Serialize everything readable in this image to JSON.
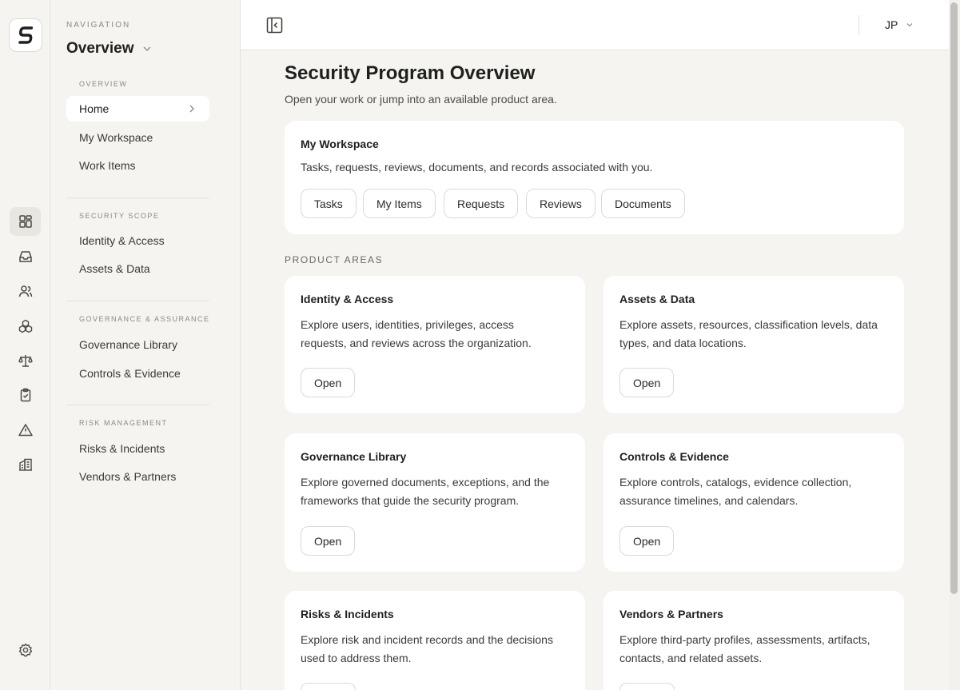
{
  "nav": {
    "eyebrow": "NAVIGATION",
    "title": "Overview",
    "sections": [
      {
        "label": "OVERVIEW",
        "items": [
          "Home",
          "My Workspace",
          "Work Items"
        ]
      },
      {
        "label": "SECURITY SCOPE",
        "items": [
          "Identity & Access",
          "Assets & Data"
        ]
      },
      {
        "label": "GOVERNANCE & ASSURANCE",
        "items": [
          "Governance Library",
          "Controls & Evidence"
        ]
      },
      {
        "label": "RISK MANAGEMENT",
        "items": [
          "Risks & Incidents",
          "Vendors & Partners"
        ]
      }
    ]
  },
  "rail": {
    "logo_letter": "S",
    "icons": [
      "dashboard-icon",
      "inbox-icon",
      "users-icon",
      "boxes-icon",
      "scale-icon",
      "clipboard-check-icon",
      "alert-triangle-icon",
      "building-icon",
      "settings-icon"
    ]
  },
  "topbar": {
    "user_initials": "JP"
  },
  "main": {
    "title": "Security Program Overview",
    "subtitle": "Open your work or jump into an available product area.",
    "workspace": {
      "title": "My Workspace",
      "desc": "Tasks, requests, reviews, documents, and records associated with you.",
      "buttons": [
        "Tasks",
        "My Items",
        "Requests",
        "Reviews",
        "Documents"
      ]
    },
    "areas_label": "PRODUCT AREAS",
    "open_label": "Open",
    "areas": [
      {
        "title": "Identity & Access",
        "desc": [
          "Explore users, identities, privileges, access",
          "requests, and reviews across the organization."
        ]
      },
      {
        "title": "Assets & Data",
        "desc": [
          "Explore assets, resources, classification levels, data",
          "types, and data locations."
        ]
      },
      {
        "title": "Governance Library",
        "desc": [
          "Explore governed documents, exceptions, and the",
          "frameworks that guide the security program."
        ]
      },
      {
        "title": "Controls & Evidence",
        "desc": [
          "Explore controls, catalogs, evidence collection,",
          "assurance timelines, and calendars."
        ]
      },
      {
        "title": "Risks & Incidents",
        "desc": [
          "Explore risk and incident records and the decisions",
          "used to address them."
        ]
      },
      {
        "title": "Vendors & Partners",
        "desc": [
          "Explore third-party profiles, assessments, artifacts,",
          "contacts, and related assets."
        ]
      }
    ]
  }
}
